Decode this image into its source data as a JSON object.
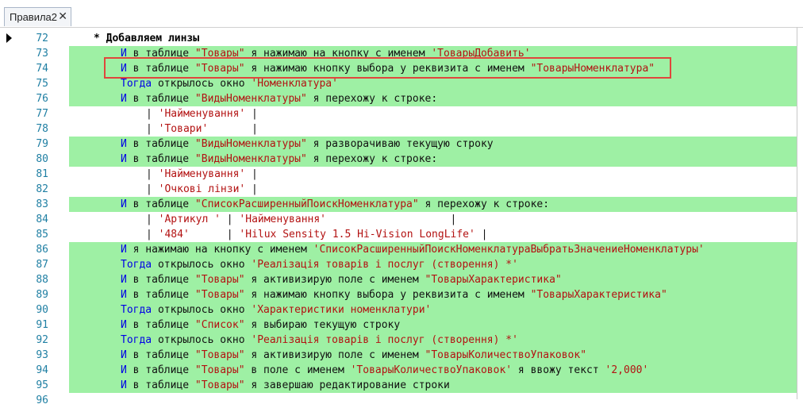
{
  "tab": {
    "label": "Правила2",
    "close": "✕"
  },
  "lines": [
    {
      "no": "72",
      "hl": false,
      "indent": 118,
      "segs": [
        {
          "c": "bold",
          "t": "* Добавляем линзы"
        }
      ]
    },
    {
      "no": "73",
      "hl": true,
      "indent": 152,
      "segs": [
        {
          "c": "kw",
          "t": "И"
        },
        {
          "c": "",
          "t": " в таблице "
        },
        {
          "c": "str",
          "t": "\"Товары\""
        },
        {
          "c": "",
          "t": " я нажимаю на кнопку с именем "
        },
        {
          "c": "str",
          "t": "'ТоварыДобавить'"
        }
      ]
    },
    {
      "no": "74",
      "hl": true,
      "indent": 152,
      "segs": [
        {
          "c": "kw",
          "t": "И"
        },
        {
          "c": "",
          "t": " в таблице "
        },
        {
          "c": "str",
          "t": "\"Товары\""
        },
        {
          "c": "",
          "t": " я нажимаю кнопку выбора у реквизита с именем "
        },
        {
          "c": "str",
          "t": "\"ТоварыНоменклатура\""
        }
      ]
    },
    {
      "no": "75",
      "hl": true,
      "indent": 152,
      "segs": [
        {
          "c": "kw",
          "t": "Тогда"
        },
        {
          "c": "",
          "t": " открылось окно "
        },
        {
          "c": "str",
          "t": "'Номенклатура'"
        }
      ]
    },
    {
      "no": "76",
      "hl": true,
      "indent": 152,
      "segs": [
        {
          "c": "kw",
          "t": "И"
        },
        {
          "c": "",
          "t": " в таблице "
        },
        {
          "c": "str",
          "t": "\"ВидыНоменклатуры\""
        },
        {
          "c": "",
          "t": " я перехожу к строке:"
        }
      ]
    },
    {
      "no": "77",
      "hl": false,
      "indent": 184,
      "segs": [
        {
          "c": "",
          "t": "| "
        },
        {
          "c": "str",
          "t": "'Найменування'"
        },
        {
          "c": "",
          "t": " |"
        }
      ]
    },
    {
      "no": "78",
      "hl": false,
      "indent": 184,
      "segs": [
        {
          "c": "",
          "t": "| "
        },
        {
          "c": "str",
          "t": "'Товари'"
        },
        {
          "c": "",
          "t": "       |"
        }
      ]
    },
    {
      "no": "79",
      "hl": true,
      "indent": 152,
      "segs": [
        {
          "c": "kw",
          "t": "И"
        },
        {
          "c": "",
          "t": " в таблице "
        },
        {
          "c": "str",
          "t": "\"ВидыНоменклатуры\""
        },
        {
          "c": "",
          "t": " я разворачиваю текущую строку"
        }
      ]
    },
    {
      "no": "80",
      "hl": true,
      "indent": 152,
      "segs": [
        {
          "c": "kw",
          "t": "И"
        },
        {
          "c": "",
          "t": " в таблице "
        },
        {
          "c": "str",
          "t": "\"ВидыНоменклатуры\""
        },
        {
          "c": "",
          "t": " я перехожу к строке:"
        }
      ]
    },
    {
      "no": "81",
      "hl": false,
      "indent": 184,
      "segs": [
        {
          "c": "",
          "t": "| "
        },
        {
          "c": "str",
          "t": "'Найменування'"
        },
        {
          "c": "",
          "t": " |"
        }
      ]
    },
    {
      "no": "82",
      "hl": false,
      "indent": 184,
      "segs": [
        {
          "c": "",
          "t": "| "
        },
        {
          "c": "str",
          "t": "'Очкові лінзи'"
        },
        {
          "c": "",
          "t": " |"
        }
      ]
    },
    {
      "no": "83",
      "hl": true,
      "indent": 152,
      "segs": [
        {
          "c": "kw",
          "t": "И"
        },
        {
          "c": "",
          "t": " в таблице "
        },
        {
          "c": "str",
          "t": "\"СписокРасширенныйПоискНоменклатура\""
        },
        {
          "c": "",
          "t": " я перехожу к строке:"
        }
      ]
    },
    {
      "no": "84",
      "hl": false,
      "indent": 184,
      "segs": [
        {
          "c": "",
          "t": "| "
        },
        {
          "c": "str",
          "t": "'Артикул '"
        },
        {
          "c": "",
          "t": " | "
        },
        {
          "c": "str",
          "t": "'Найменування'"
        },
        {
          "c": "",
          "t": "                    |"
        }
      ]
    },
    {
      "no": "85",
      "hl": false,
      "indent": 184,
      "segs": [
        {
          "c": "",
          "t": "| "
        },
        {
          "c": "str",
          "t": "'484'"
        },
        {
          "c": "",
          "t": "      | "
        },
        {
          "c": "str",
          "t": "'Hilux Sensity 1.5 Hi-Vision LongLife'"
        },
        {
          "c": "",
          "t": " |"
        }
      ]
    },
    {
      "no": "86",
      "hl": true,
      "indent": 152,
      "segs": [
        {
          "c": "kw",
          "t": "И"
        },
        {
          "c": "",
          "t": " я нажимаю на кнопку с именем "
        },
        {
          "c": "str",
          "t": "'СписокРасширенныйПоискНоменклатураВыбратьЗначениеНоменклатуры'"
        }
      ]
    },
    {
      "no": "87",
      "hl": true,
      "indent": 152,
      "segs": [
        {
          "c": "kw",
          "t": "Тогда"
        },
        {
          "c": "",
          "t": " открылось окно "
        },
        {
          "c": "str",
          "t": "'Реалізація товарів і послуг (створення) *'"
        }
      ]
    },
    {
      "no": "88",
      "hl": true,
      "indent": 152,
      "segs": [
        {
          "c": "kw",
          "t": "И"
        },
        {
          "c": "",
          "t": " в таблице "
        },
        {
          "c": "str",
          "t": "\"Товары\""
        },
        {
          "c": "",
          "t": " я активизирую поле с именем "
        },
        {
          "c": "str",
          "t": "\"ТоварыХарактеристика\""
        }
      ]
    },
    {
      "no": "89",
      "hl": true,
      "indent": 152,
      "segs": [
        {
          "c": "kw",
          "t": "И"
        },
        {
          "c": "",
          "t": " в таблице "
        },
        {
          "c": "str",
          "t": "\"Товары\""
        },
        {
          "c": "",
          "t": " я нажимаю кнопку выбора у реквизита с именем "
        },
        {
          "c": "str",
          "t": "\"ТоварыХарактеристика\""
        }
      ]
    },
    {
      "no": "90",
      "hl": true,
      "indent": 152,
      "segs": [
        {
          "c": "kw",
          "t": "Тогда"
        },
        {
          "c": "",
          "t": " открылось окно "
        },
        {
          "c": "str",
          "t": "'Характеристики номенклатури'"
        }
      ]
    },
    {
      "no": "91",
      "hl": true,
      "indent": 152,
      "segs": [
        {
          "c": "kw",
          "t": "И"
        },
        {
          "c": "",
          "t": " в таблице "
        },
        {
          "c": "str",
          "t": "\"Список\""
        },
        {
          "c": "",
          "t": " я выбираю текущую строку"
        }
      ]
    },
    {
      "no": "92",
      "hl": true,
      "indent": 152,
      "segs": [
        {
          "c": "kw",
          "t": "Тогда"
        },
        {
          "c": "",
          "t": " открылось окно "
        },
        {
          "c": "str",
          "t": "'Реалізація товарів і послуг (створення) *'"
        }
      ]
    },
    {
      "no": "93",
      "hl": true,
      "indent": 152,
      "segs": [
        {
          "c": "kw",
          "t": "И"
        },
        {
          "c": "",
          "t": " в таблице "
        },
        {
          "c": "str",
          "t": "\"Товары\""
        },
        {
          "c": "",
          "t": " я активизирую поле с именем "
        },
        {
          "c": "str",
          "t": "\"ТоварыКоличествоУпаковок\""
        }
      ]
    },
    {
      "no": "94",
      "hl": true,
      "indent": 152,
      "segs": [
        {
          "c": "kw",
          "t": "И"
        },
        {
          "c": "",
          "t": " в таблице "
        },
        {
          "c": "str",
          "t": "\"Товары\""
        },
        {
          "c": "",
          "t": " в поле с именем "
        },
        {
          "c": "str",
          "t": "'ТоварыКоличествоУпаковок'"
        },
        {
          "c": "",
          "t": " я ввожу текст "
        },
        {
          "c": "str",
          "t": "'2,000'"
        }
      ]
    },
    {
      "no": "95",
      "hl": true,
      "indent": 152,
      "segs": [
        {
          "c": "kw",
          "t": "И"
        },
        {
          "c": "",
          "t": " в таблице "
        },
        {
          "c": "str",
          "t": "\"Товары\""
        },
        {
          "c": "",
          "t": " я завершаю редактирование строки"
        }
      ]
    },
    {
      "no": "96",
      "hl": false,
      "indent": 152,
      "segs": []
    }
  ],
  "colors": {
    "highlight": "#9ef0a4",
    "keyword": "#0000e6",
    "string": "#b31212",
    "linenumber": "#1f7fa3",
    "annotation": "#e0473c"
  },
  "current_line": "72",
  "annotated_line": "74"
}
